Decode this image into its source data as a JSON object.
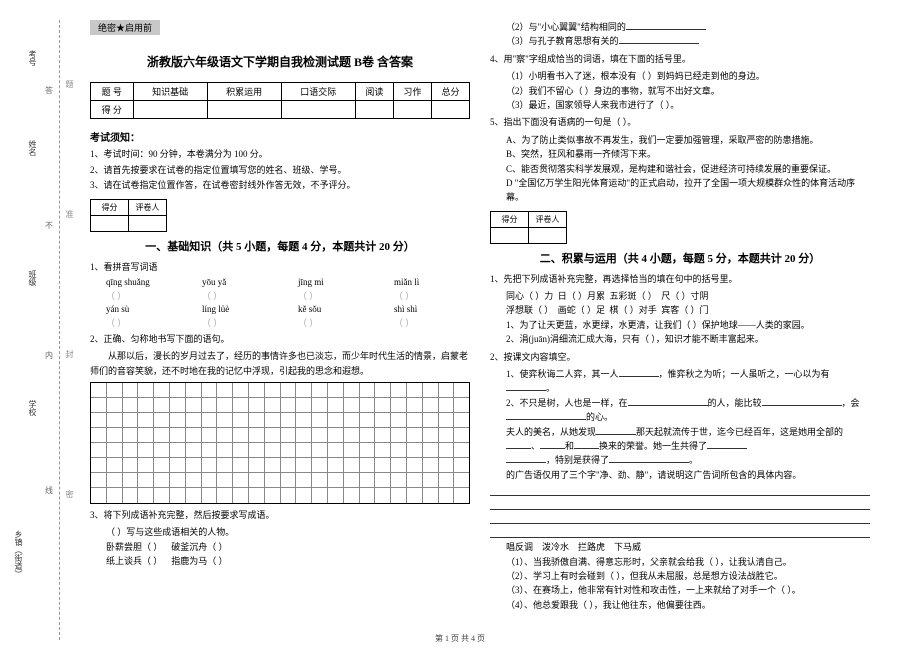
{
  "binding": {
    "l1": "考号",
    "l2": "姓名",
    "l3": "班级",
    "l4": "学校",
    "l5": "乡镇（街道）",
    "m1": "答",
    "m2": "不",
    "m3": "内",
    "m4": "线",
    "g1": "题",
    "g2": "准",
    "g3": "封",
    "g4": "密"
  },
  "secret": "绝密★启用前",
  "title": "浙教版六年级语文下学期自我检测试题 B卷 含答案",
  "scoreHeaders": {
    "h0": "题 号",
    "h1": "知识基础",
    "h2": "积累运用",
    "h3": "口语交际",
    "h4": "阅读",
    "h5": "习作",
    "h6": "总分"
  },
  "scoreRow": "得 分",
  "notesTitle": "考试须知：",
  "notes": {
    "n1": "1、考试时间：90 分钟，本卷满分为 100 分。",
    "n2": "2、请首先按要求在试卷的指定位置填写您的姓名、班级、学号。",
    "n3": "3、请在试卷指定位置作答，在试卷密封线外作答无效，不予评分。"
  },
  "scoreBox": {
    "a": "得分",
    "b": "评卷人"
  },
  "p1title": "一、基础知识（共 5 小题，每题 4 分，本题共计 20 分）",
  "p2title": "二、积累与运用（共 4 小题，每题 5 分，本题共计 20 分）",
  "p1": {
    "q1": "1、看拼音写词语",
    "py": {
      "a": "qīng shuǎng",
      "b": "yōu yǎ",
      "c": "jīng mì",
      "d": "miǎn lì",
      "e": "yán sù",
      "f": "líng lüè",
      "g": "kě sǒu",
      "h": "shì shì"
    },
    "q2": "2、正确、匀称地书写下面的语句。",
    "q2text": "从那以后，漫长的岁月过去了，经历的事情许多也已淡忘，而少年时代生活的情景，启蒙老师们的音容笑貌，还不时地在我的记忆中浮现，引起我的思念和遐想。",
    "q3": "3、将下列成语补充完整，然后按要求写成语。",
    "q3a": "（  ）写与这些成语相关的人物。",
    "q3o1a": "卧薪尝胆（      ）",
    "q3o1b": "破釜沉舟（      ）",
    "q3o2a": "纸上谈兵（      ）",
    "q3o2b": "指鹿为马（      ）",
    "q4a": "（2）与\"小心翼翼\"结构相同的",
    "q4b": "（3）与孔子教育思想有关的",
    "q5": "4、用\"察\"字组成恰当的词语，填在下面的括号里。",
    "q5a": "（1）小明看书入了迷，根本没有（        ）到妈妈已经走到他的身边。",
    "q5b": "（2）我们不留心（        ）身边的事物，就写不出好文章。",
    "q5c": "（3）最近，国家领导人来我市进行了（        ）。",
    "q6": "5、指出下面没有语病的一句是（      ）。",
    "q6a": "A、为了防止类似事故不再发生，我们一定要加强管理，采取严密的防患措施。",
    "q6b": "B、突然，狂风和暴雨一齐倾泻下来。",
    "q6c": "C、能否贯彻落实科学发展观，是构建和谐社会，促进经济可持续发展的重要保证。",
    "q6d": "D \"全国亿万学生阳光体育运动\"的正式启动，拉开了全国一项大规模群众性的体育活动序幕。"
  },
  "p2": {
    "q1": "1、先把下列成语补充完整，再选择恰当的填在句中的括号里。",
    "r1a": "同心（  ）力",
    "r1b": "日（  ）月累",
    "r1c": "五彩斑（  ）",
    "r1d": "尺（  ）寸阴",
    "r2a": "浮想联（  ）",
    "r2b": "画蛇（  ）足",
    "r2c": "棋（  ）对手",
    "r2d": "宾客（  ）门",
    "s1": "1、为了让天更蓝，水更绿，水更清，让我们（            ）保护地球——人类的家园。",
    "s2": "2、涓(juān)涓细流汇成大海，只有（            ），知识才能不断丰富起来。",
    "q2": "2、按课文内容填空。",
    "s3a": "1、使弈秋诲二人弈，其一人",
    "s3b": "，惟弈秋之为听；一人虽听之，一心以为有",
    "s4a": "2、不只是树，人也是一样，在",
    "s4b": "的人，能比较",
    "s4c": "，会",
    "s4d": "的心。",
    "s5a": "夫人的美名，从她发现",
    "s5b": "那天起就流传于世，迄今已经百年，这是她用全部的",
    "s5c": "、",
    "s5d": "和",
    "s5e": "换来的荣誉。她一生共得了",
    "s6": "，特别是获得了",
    "s7a": "的广告语仅用了三个字\"净、劲、静\"，请说明这广告词所包含的具体内容。",
    "blank": "",
    "l1": "唱反调",
    "l2": "泼冷水",
    "l3": "拦路虎",
    "l4": "下马威",
    "o1": "（1）、当我骄傲自满、得意忘形时，父亲就会给我（            ），让我认清自己。",
    "o2": "（2）、学习上有时会碰到（            ），但我从未屈服，总是想方设法战胜它。",
    "o3": "（3）、在赛场上，他非常有针对性和攻击性，一上来就给了对手一个（            ）。",
    "o4": "（4）、他总爱跟我（            ），我让他往东，他偏要往西。"
  },
  "footer": "第 1 页 共 4 页"
}
